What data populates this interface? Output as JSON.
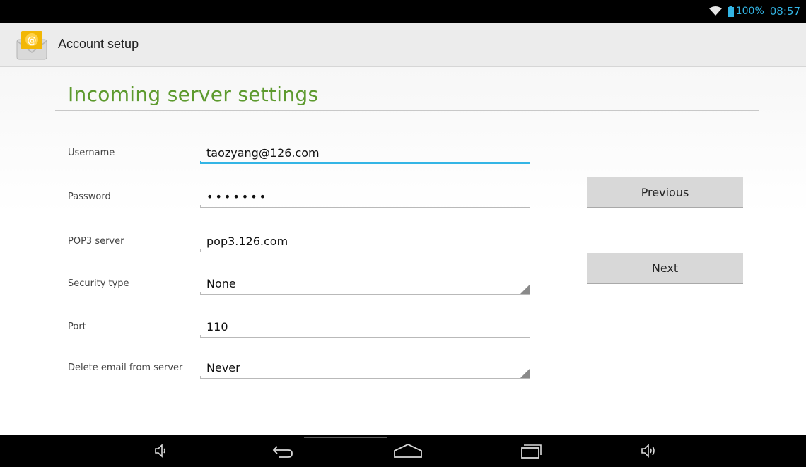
{
  "status": {
    "battery": "100%",
    "time": "08:57"
  },
  "actionbar": {
    "title": "Account setup",
    "icon": "email-app-icon"
  },
  "page": {
    "title": "Incoming server settings"
  },
  "form": {
    "username": {
      "label": "Username",
      "value": "taozyang@126.com"
    },
    "password": {
      "label": "Password",
      "value": "•••••••"
    },
    "server": {
      "label": "POP3 server",
      "value": "pop3.126.com"
    },
    "security": {
      "label": "Security type",
      "value": "None"
    },
    "port": {
      "label": "Port",
      "value": "110"
    },
    "delete": {
      "label": "Delete email from server",
      "value": "Never"
    }
  },
  "buttons": {
    "previous": "Previous",
    "next": "Next"
  },
  "navbar": {
    "icons": [
      "volume-down-icon",
      "back-icon",
      "home-icon",
      "recent-apps-icon",
      "volume-up-icon"
    ]
  },
  "colors": {
    "accent": "#33b5e5",
    "title_green": "#5d9a2e"
  }
}
